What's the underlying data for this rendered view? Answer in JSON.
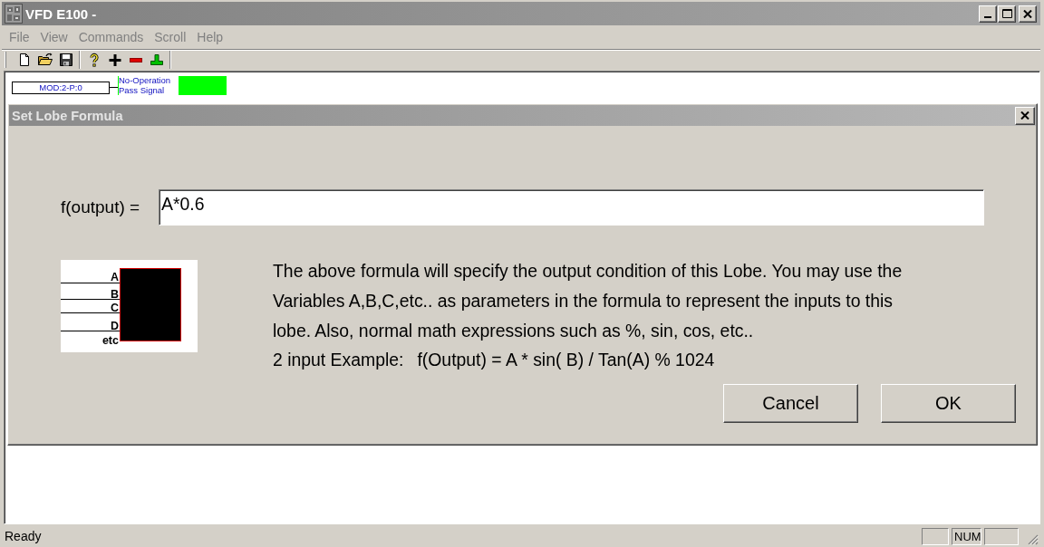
{
  "window": {
    "title": "VFD E100 -"
  },
  "menu": [
    {
      "label": "File",
      "disabled": true
    },
    {
      "label": "View",
      "disabled": true
    },
    {
      "label": "Commands",
      "disabled": true
    },
    {
      "label": "Scroll",
      "disabled": true
    },
    {
      "label": "Help",
      "disabled": true
    }
  ],
  "canvas": {
    "module": {
      "label": "MOD:2-P:0"
    },
    "operation": {
      "lines": [
        "No-Operation",
        "Pass Signal"
      ]
    }
  },
  "dialog": {
    "title": "Set Lobe Formula",
    "formula": {
      "label": "f(output) =",
      "value": "A*0.6"
    },
    "diagram": {
      "inputs": [
        "A",
        "B",
        "C",
        "D",
        "etc"
      ]
    },
    "description": "The above formula will specify the output condition of this Lobe. You may use the Variables A,B,C,etc.. as parameters in the formula to represent the inputs to this lobe. Also, normal math expressions such as %, sin, cos, etc..",
    "example": {
      "label": "2 input Example:",
      "formula": "f(Output) = A * sin( B) / Tan(A) % 1024"
    },
    "buttons": [
      {
        "label": "Cancel"
      },
      {
        "label": "OK"
      }
    ]
  },
  "status_bar": {
    "message": "Ready",
    "panels": [
      {
        "kind": "empty"
      },
      {
        "kind": "text",
        "label": "NUM"
      },
      {
        "kind": "empty"
      }
    ]
  }
}
